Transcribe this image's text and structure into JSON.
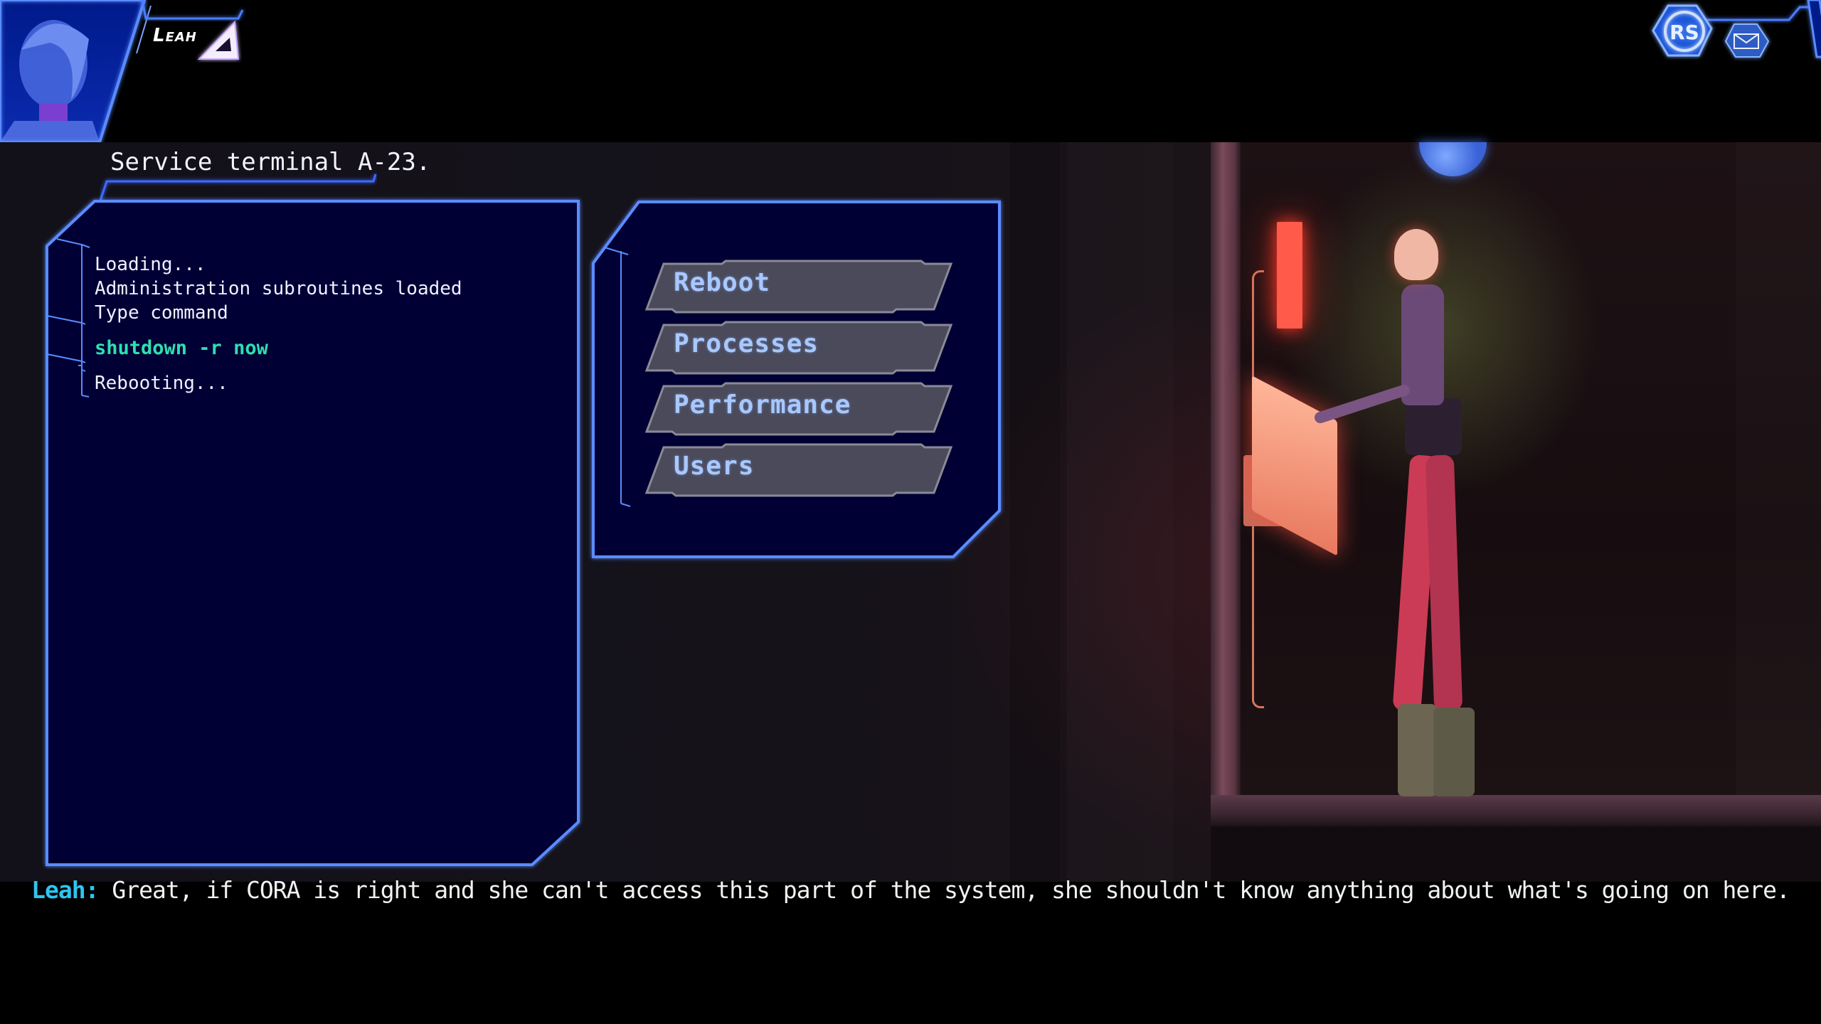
{
  "hud": {
    "speaker": {
      "name": "Leah",
      "portrait": "leah-portrait",
      "faction_icon": "triangle-emblem-icon"
    },
    "top_right": {
      "badge_label": "RS",
      "badge_icon": "rs-hexagon-badge-icon",
      "message_icon": "envelope-icon"
    }
  },
  "location": {
    "label": "Service terminal A-23."
  },
  "terminal_log": {
    "lines": [
      {
        "text": "Loading...",
        "type": "output"
      },
      {
        "text": "Administration subroutines loaded",
        "type": "output"
      },
      {
        "text": "Type command",
        "type": "output"
      },
      {
        "text": "shutdown -r now",
        "type": "command"
      },
      {
        "text": "Rebooting...",
        "type": "output"
      }
    ]
  },
  "menu": {
    "options": [
      {
        "label": "Reboot"
      },
      {
        "label": "Processes"
      },
      {
        "label": "Performance"
      },
      {
        "label": "Users"
      }
    ]
  },
  "dialogue": {
    "speaker": "Leah:",
    "text": " Great, if CORA is right and she can't access this part of the system, she shouldn't know anything about what's going on here."
  },
  "colors": {
    "panel_border": "#3d6bff",
    "panel_fill": "#000535",
    "command_text": "#2fe0b0",
    "speaker_text": "#2ec4f0",
    "button_text": "#a8c8ff",
    "button_fill": "#4a4a5a"
  }
}
